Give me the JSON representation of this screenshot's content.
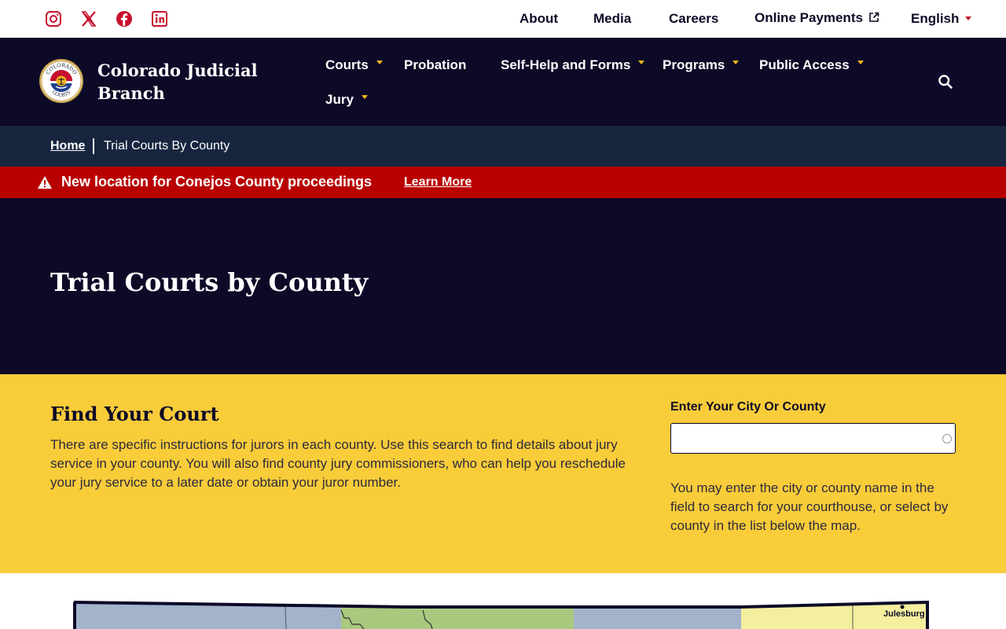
{
  "utility_bar": {
    "social_icons": [
      "instagram-icon",
      "x-icon",
      "facebook-icon",
      "linkedin-icon"
    ],
    "links": {
      "about": "About",
      "media": "Media",
      "careers": "Careers",
      "online_payments": "Online Payments",
      "language": "English"
    }
  },
  "header": {
    "brand_line1": "Colorado Judicial",
    "brand_line2": "Branch",
    "seal_text_top": "COLORADO",
    "seal_text_bottom": "COURTS",
    "nav": {
      "courts": "Courts",
      "probation": "Probation",
      "self_help": "Self-Help and Forms",
      "programs": "Programs",
      "public_access": "Public Access",
      "jury": "Jury"
    }
  },
  "breadcrumb": {
    "home": "Home",
    "current": "Trial Courts By County"
  },
  "alert": {
    "message": "New location for Conejos County proceedings",
    "link": "Learn More"
  },
  "hero": {
    "title": "Trial Courts by County"
  },
  "find_court": {
    "title": "Find Your Court",
    "description": "There are specific instructions for jurors in each county. Use this search to find details about jury service in your county. You will also find county jury commissioners, who can help you reschedule your jury service to a later date or obtain your juror number.",
    "field_label": "Enter Your City Or County",
    "field_value": "",
    "help_text": "You may enter the city or county name in the field to search for your courthouse, or select by county in the list below the map."
  },
  "map": {
    "labels": {
      "julesburg": "Julesburg"
    }
  },
  "colors": {
    "navy": "#0c0a27",
    "breadcrumb_bg": "#17253f",
    "alert_red": "#b90000",
    "gold": "#f9cc3a",
    "caret_gold": "#f2b51c",
    "social_red": "#c8102e"
  }
}
